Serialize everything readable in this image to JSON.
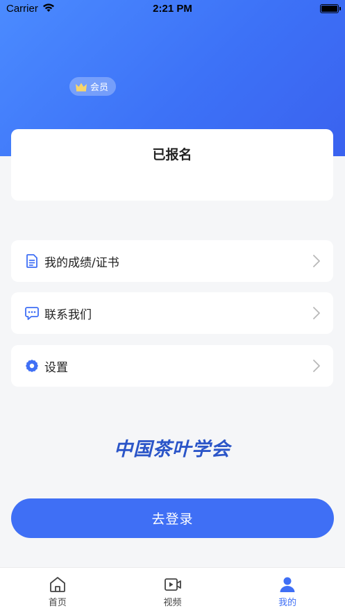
{
  "status_bar": {
    "carrier": "Carrier",
    "time": "2:21 PM"
  },
  "profile": {
    "vip_badge_label": "会员",
    "enroll_title": "已报名"
  },
  "menu": {
    "items": [
      {
        "label": "我的成绩/证书",
        "icon": "document-icon"
      },
      {
        "label": "联系我们",
        "icon": "chat-bubble-icon"
      },
      {
        "label": "设置",
        "icon": "gear-icon"
      }
    ]
  },
  "logo_text": "中国茶叶学会",
  "login_button_label": "去登录",
  "tabbar": {
    "tabs": [
      {
        "label": "首页",
        "icon": "home-icon"
      },
      {
        "label": "视频",
        "icon": "video-icon"
      },
      {
        "label": "我的",
        "icon": "user-icon",
        "active": true
      }
    ]
  },
  "colors": {
    "accent": "#3f6ff5",
    "hero_start": "#4b8bff",
    "hero_end": "#3a62ef"
  }
}
